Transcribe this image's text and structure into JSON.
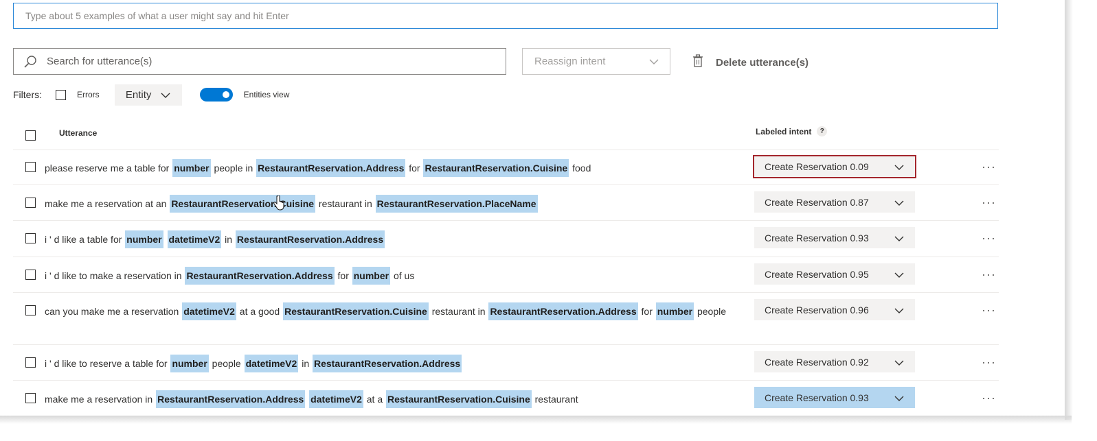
{
  "example_input": {
    "placeholder": "Type about 5 examples of what a user might say and hit Enter"
  },
  "toolbar": {
    "search_placeholder": "Search for utterance(s)",
    "reassign_label": "Reassign intent",
    "delete_label": "Delete utterance(s)"
  },
  "filters": {
    "label": "Filters:",
    "errors_label": "Errors",
    "entity_label": "Entity",
    "entities_view_label": "Entities view",
    "entities_view_on": true
  },
  "table": {
    "col_utterance": "Utterance",
    "col_intent": "Labeled intent",
    "help": "?",
    "more": "···",
    "rows": [
      {
        "segments": [
          {
            "t": "please reserve me a table for "
          },
          {
            "e": "number"
          },
          {
            "t": " people in "
          },
          {
            "e": "RestaurantReservation.Address"
          },
          {
            "t": " for "
          },
          {
            "e": "RestaurantReservation.Cuisine"
          },
          {
            "t": " food"
          }
        ],
        "intent": "Create Reservation 0.09",
        "state": "error"
      },
      {
        "segments": [
          {
            "t": "make me a reservation at an "
          },
          {
            "e": "RestaurantReservation.Cuisine"
          },
          {
            "t": " restaurant in "
          },
          {
            "e": "RestaurantReservation.PlaceName"
          }
        ],
        "intent": "Create Reservation 0.87",
        "state": ""
      },
      {
        "segments": [
          {
            "t": "i ' d like a table for "
          },
          {
            "e": "number"
          },
          {
            "t": " "
          },
          {
            "e": "datetimeV2"
          },
          {
            "t": " in "
          },
          {
            "e": "RestaurantReservation.Address"
          }
        ],
        "intent": "Create Reservation 0.93",
        "state": ""
      },
      {
        "segments": [
          {
            "t": "i ' d like to make a reservation in "
          },
          {
            "e": "RestaurantReservation.Address"
          },
          {
            "t": " for "
          },
          {
            "e": "number"
          },
          {
            "t": " of us"
          }
        ],
        "intent": "Create Reservation 0.95",
        "state": ""
      },
      {
        "segments": [
          {
            "t": "can you make me a reservation "
          },
          {
            "e": "datetimeV2"
          },
          {
            "t": " at a good "
          },
          {
            "e": "RestaurantReservation.Cuisine"
          },
          {
            "t": " restaurant in "
          },
          {
            "e": "RestaurantReservation.Address"
          },
          {
            "t": " for "
          },
          {
            "e": "number"
          },
          {
            "t": " people"
          }
        ],
        "intent": "Create Reservation 0.96",
        "state": ""
      },
      {
        "segments": [
          {
            "t": "i ' d like to reserve a table for "
          },
          {
            "e": "number"
          },
          {
            "t": " people "
          },
          {
            "e": "datetimeV2"
          },
          {
            "t": " in "
          },
          {
            "e": "RestaurantReservation.Address"
          }
        ],
        "intent": "Create Reservation 0.92",
        "state": ""
      },
      {
        "segments": [
          {
            "t": "make me a reservation in "
          },
          {
            "e": "RestaurantReservation.Address"
          },
          {
            "t": " "
          },
          {
            "e": "datetimeV2"
          },
          {
            "t": " at a "
          },
          {
            "e": "RestaurantReservation.Cuisine"
          },
          {
            "t": " restaurant"
          }
        ],
        "intent": "Create Reservation 0.93",
        "state": "selected"
      }
    ]
  }
}
